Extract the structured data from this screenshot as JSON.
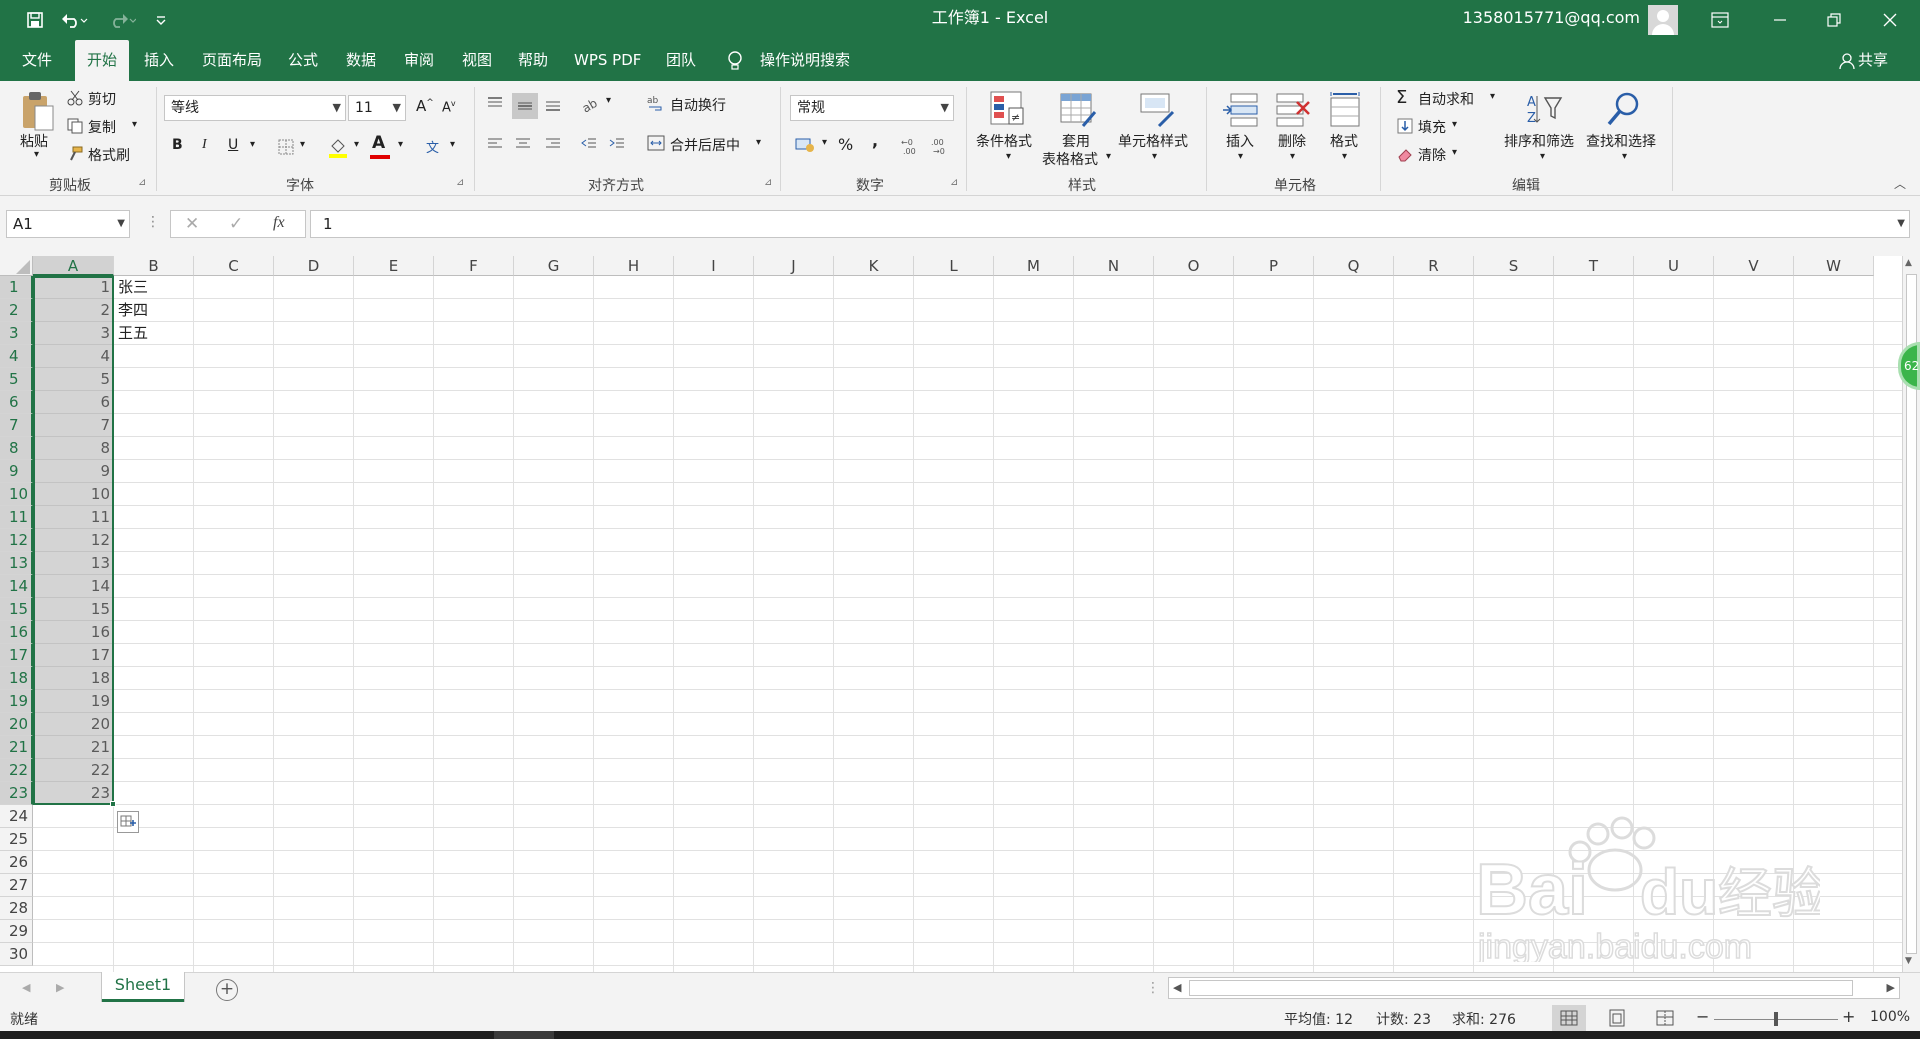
{
  "window": {
    "title": "工作簿1 - Excel",
    "account": "1358015771@qq.com"
  },
  "tabs": [
    {
      "label": "文件"
    },
    {
      "label": "开始"
    },
    {
      "label": "插入"
    },
    {
      "label": "页面布局"
    },
    {
      "label": "公式"
    },
    {
      "label": "数据"
    },
    {
      "label": "审阅"
    },
    {
      "label": "视图"
    },
    {
      "label": "帮助"
    },
    {
      "label": "WPS PDF"
    },
    {
      "label": "团队"
    }
  ],
  "tell_me": "操作说明搜索",
  "share": "共享",
  "ribbon": {
    "clipboard": {
      "paste": "粘贴",
      "cut": "剪切",
      "copy": "复制",
      "format_painter": "格式刷",
      "group": "剪贴板"
    },
    "font": {
      "name": "等线",
      "size": "11",
      "group": "字体",
      "bold": "B",
      "italic": "I",
      "underline": "U",
      "grow": "A",
      "shrink": "A",
      "color_a": "A",
      "pinyin": "文"
    },
    "alignment": {
      "wrap": "自动换行",
      "merge": "合并后居中",
      "group": "对齐方式"
    },
    "number": {
      "format": "常规",
      "percent": "%",
      "comma": ",",
      "group": "数字"
    },
    "styles": {
      "conditional": "条件格式",
      "table1": "套用",
      "table2": "表格格式",
      "cell_styles": "单元格样式",
      "group": "样式"
    },
    "cells": {
      "insert": "插入",
      "delete": "删除",
      "format": "格式",
      "group": "单元格"
    },
    "editing": {
      "autosum": "自动求和",
      "fill": "填充",
      "clear": "清除",
      "sort": "排序和筛选",
      "find": "查找和选择",
      "group": "编辑"
    }
  },
  "formula_bar": {
    "name_box": "A1",
    "fx": "fx",
    "value": "1"
  },
  "columns": [
    "A",
    "B",
    "C",
    "D",
    "E",
    "F",
    "G",
    "H",
    "I",
    "J",
    "K",
    "L",
    "M",
    "N",
    "O",
    "P",
    "Q",
    "R",
    "S",
    "T",
    "U",
    "V",
    "W"
  ],
  "rows": [
    "1",
    "2",
    "3",
    "4",
    "5",
    "6",
    "7",
    "8",
    "9",
    "10",
    "11",
    "12",
    "13",
    "14",
    "15",
    "16",
    "17",
    "18",
    "19",
    "20",
    "21",
    "22",
    "23",
    "24",
    "25",
    "26",
    "27",
    "28",
    "29",
    "30"
  ],
  "col_a_values": [
    "1",
    "2",
    "3",
    "4",
    "5",
    "6",
    "7",
    "8",
    "9",
    "10",
    "11",
    "12",
    "13",
    "14",
    "15",
    "16",
    "17",
    "18",
    "19",
    "20",
    "21",
    "22",
    "23"
  ],
  "col_b_values": [
    "张三",
    "李四",
    "王五"
  ],
  "sheet": {
    "name": "Sheet1"
  },
  "status": {
    "ready": "就绪",
    "average": "平均值: 12",
    "count": "计数: 23",
    "sum": "求和: 276",
    "zoom": "100%",
    "minus": "−",
    "plus": "+"
  },
  "floating_badge": "62",
  "watermark": "Baidu经验 jingyan.baidu.com",
  "colors": {
    "excel_green": "#217346",
    "ribbon_bg": "#f3f3f3",
    "selection": "#d2d2d2"
  }
}
